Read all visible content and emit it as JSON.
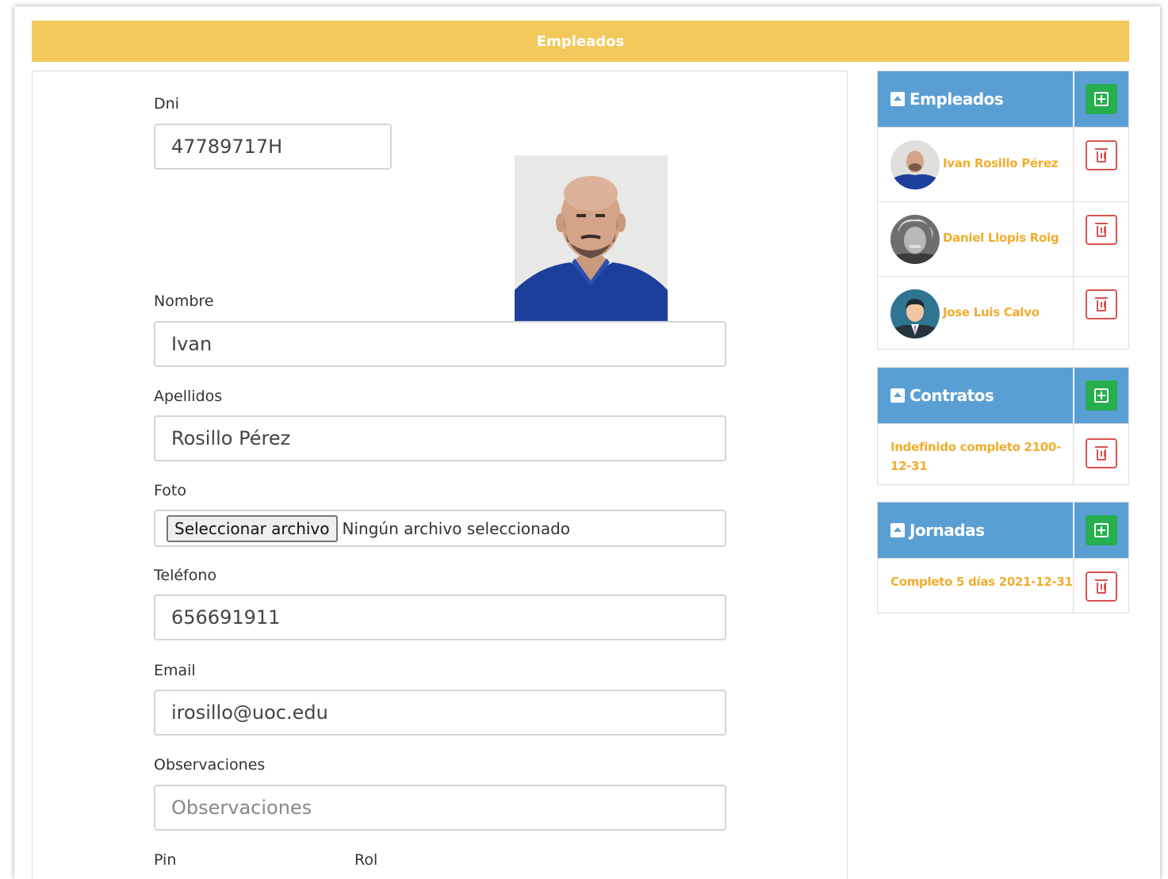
{
  "header": {
    "title": "Empleados"
  },
  "form": {
    "dni": {
      "label": "Dni",
      "value": "47789717H"
    },
    "nombre": {
      "label": "Nombre",
      "value": "Ivan"
    },
    "apellidos": {
      "label": "Apellidos",
      "value": "Rosillo Pérez"
    },
    "foto": {
      "label": "Foto",
      "button_label": "Seleccionar archivo",
      "status": "Ningún archivo seleccionado"
    },
    "telefono": {
      "label": "Teléfono",
      "value": "656691911"
    },
    "email": {
      "label": "Email",
      "value": "irosillo@uoc.edu"
    },
    "observaciones": {
      "label": "Observaciones",
      "placeholder": "Observaciones"
    },
    "pin": {
      "label": "Pin"
    },
    "rol": {
      "label": "Rol"
    }
  },
  "sidebar": {
    "empleados": {
      "title": "Empleados",
      "items": [
        {
          "name": "Ivan Rosillo Pérez"
        },
        {
          "name": "Daniel Llopis Roig"
        },
        {
          "name": "Jose Luis Calvo"
        }
      ]
    },
    "contratos": {
      "title": "Contratos",
      "items": [
        {
          "line1": "Indefinido completo 2100-",
          "line2": "12-31"
        }
      ]
    },
    "jornadas": {
      "title": "Jornadas",
      "items": [
        {
          "text": "Completo 5 días 2021-12-31"
        }
      ]
    }
  },
  "colors": {
    "header_bar": "#f3c95c",
    "card_header": "#5a9fd4",
    "add_button": "#27ae4f",
    "delete_button": "#d9534f",
    "link_text": "#f0ad2e"
  },
  "icons": {
    "collapse": "chevron-up-square-icon",
    "add": "plus-square-icon",
    "delete": "trash-icon"
  }
}
